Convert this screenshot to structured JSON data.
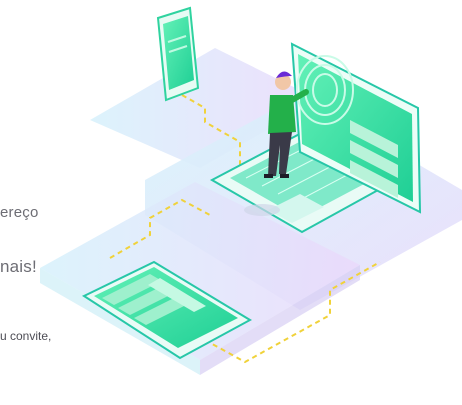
{
  "text_fragments": {
    "line1": "ereço",
    "line2": "nais!",
    "line3": "u convite,"
  },
  "illustration": {
    "name": "isometric-devices-illustration",
    "colors": {
      "screen_green": "#2ee59a",
      "screen_teal": "#27c7a8",
      "device_body": "#e9fbf6",
      "platform_lilac": "#e6dcfb",
      "platform_blue": "#d6f1fb",
      "dashed_path": "#f0d23a",
      "person_shirt": "#23b04a",
      "person_hair": "#6a2bd6",
      "person_pants": "#3a3a48"
    }
  }
}
